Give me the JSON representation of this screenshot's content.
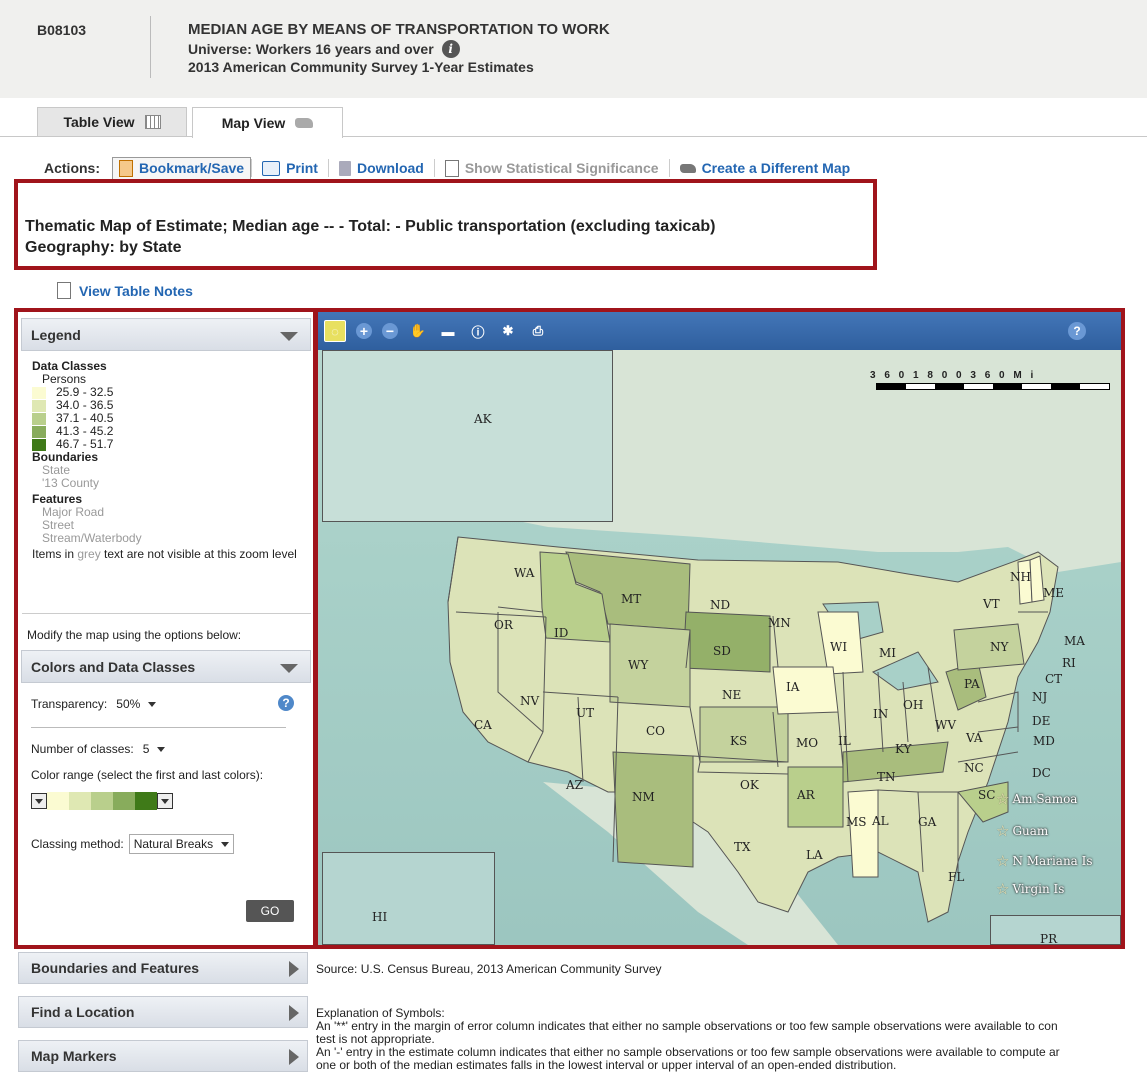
{
  "header": {
    "table_id": "B08103",
    "title": "MEDIAN AGE BY MEANS OF TRANSPORTATION TO WORK",
    "universe": "Universe: Workers 16 years and over",
    "survey": "2013 American Community Survey 1-Year Estimates"
  },
  "tabs": [
    {
      "label": "Table View",
      "icon": "grid-icon"
    },
    {
      "label": "Map View",
      "icon": "us-map-icon"
    }
  ],
  "actions": {
    "label": "Actions:",
    "bookmark": "Bookmark/Save",
    "print": "Print",
    "download": "Download",
    "significance": "Show Statistical Significance",
    "create_map": "Create a Different Map"
  },
  "thematic": {
    "line1": "Thematic Map of Estimate; Median age -- - Total: - Public transportation (excluding taxicab)",
    "line2": "Geography: by State"
  },
  "view_table_notes": "View Table Notes",
  "legend": {
    "header": "Legend",
    "data_classes": "Data Classes",
    "persons": "Persons",
    "classes": [
      {
        "label": "25.9 - 32.5",
        "color": "#fbfbd2"
      },
      {
        "label": "34.0 - 36.5",
        "color": "#dfe8b3"
      },
      {
        "label": "37.1 - 40.5",
        "color": "#b9cf8c"
      },
      {
        "label": "41.3 - 45.2",
        "color": "#88ac5c"
      },
      {
        "label": "46.7 - 51.7",
        "color": "#3f7a18"
      }
    ],
    "boundaries": "Boundaries",
    "boundary_items": [
      "State",
      "'13 County"
    ],
    "features": "Features",
    "feature_items": [
      "Major Road",
      "Street",
      "Stream/Waterbody"
    ],
    "note_pre": "Items in ",
    "note_grey": "grey",
    "note_post": " text are not visible at this zoom level"
  },
  "modify_text": "Modify the map using the options below:",
  "colors_panel": {
    "header": "Colors and Data Classes",
    "transparency_label": "Transparency:",
    "transparency_value": "50%",
    "classes_label": "Number of classes:",
    "classes_value": "5",
    "range_label": "Color range (select the first and last colors):",
    "range_colors": [
      "#fbfbd2",
      "#dfe8b3",
      "#b9cf8c",
      "#88ac5c",
      "#3f7a18"
    ],
    "method_label": "Classing method:",
    "method_value": "Natural Breaks",
    "go": "GO"
  },
  "bottom_panels": [
    "Boundaries and Features",
    "Find a Location",
    "Map Markers"
  ],
  "source": "Source: U.S. Census Bureau, 2013 American Community Survey",
  "explanation": {
    "title": "Explanation of Symbols:",
    "lines": [
      "An '**' entry in the margin of error column indicates that either no sample observations or too few sample observations were available to con",
      "test is not appropriate.",
      "An '-' entry in the estimate column indicates that either no sample observations or too few sample observations were available to compute ar",
      "one or both of the median estimates falls in the lowest interval or upper interval of an open-ended distribution."
    ]
  },
  "map": {
    "scale_text": "3 6 0 1 8 0 0        3 6 0   M i",
    "help": "?",
    "states": [
      "AK",
      "WA",
      "OR",
      "CA",
      "NV",
      "ID",
      "MT",
      "WY",
      "UT",
      "AZ",
      "CO",
      "NM",
      "ND",
      "SD",
      "NE",
      "KS",
      "OK",
      "TX",
      "MN",
      "IA",
      "MO",
      "AR",
      "LA",
      "WI",
      "IL",
      "MS",
      "MI",
      "IN",
      "KY",
      "TN",
      "AL",
      "OH",
      "GA",
      "FL",
      "SC",
      "NC",
      "VA",
      "WV",
      "PA",
      "NY",
      "VT",
      "NH",
      "ME",
      "MA",
      "RI",
      "CT",
      "NJ",
      "DE",
      "MD",
      "DC",
      "HI",
      "PR"
    ],
    "territories": [
      "Am.Samoa",
      "Guam",
      "N Mariana Is",
      "Virgin Is"
    ]
  }
}
